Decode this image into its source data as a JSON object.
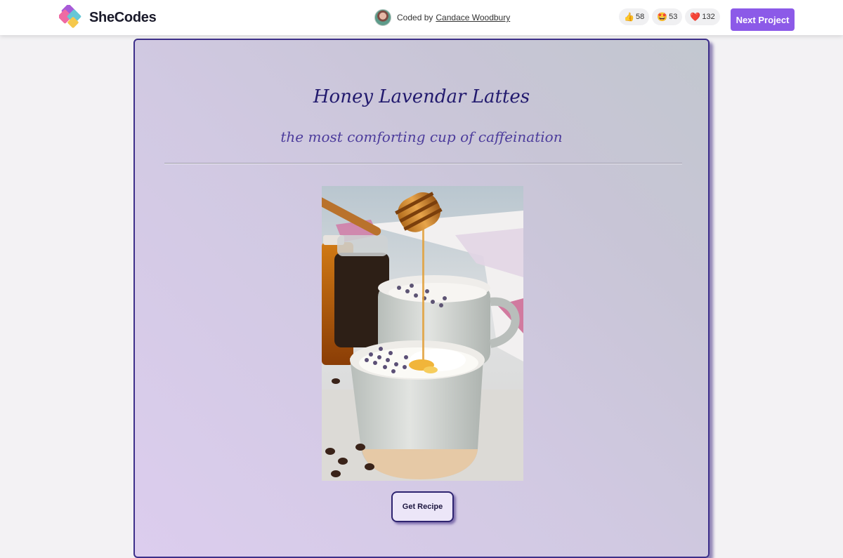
{
  "header": {
    "brand": "SheCodes",
    "coded_by_prefix": "Coded by",
    "author_name": "Candace Woodbury",
    "reactions": [
      {
        "icon": "thumbs-up-icon",
        "emoji": "👍",
        "count": "58"
      },
      {
        "icon": "star-struck-icon",
        "emoji": "🤩",
        "count": "53"
      },
      {
        "icon": "heart-icon",
        "emoji": "❤️",
        "count": "132"
      }
    ],
    "next_label": "Next Project"
  },
  "card": {
    "title": "Honey Lavendar Lattes",
    "subtitle": "the most comforting cup of caffeination",
    "button_label": "Get Recipe"
  },
  "colors": {
    "accent": "#8c5ae8",
    "title": "#221a6e",
    "subtitle": "#4c3c9c",
    "card_border": "#3d2f8a"
  }
}
